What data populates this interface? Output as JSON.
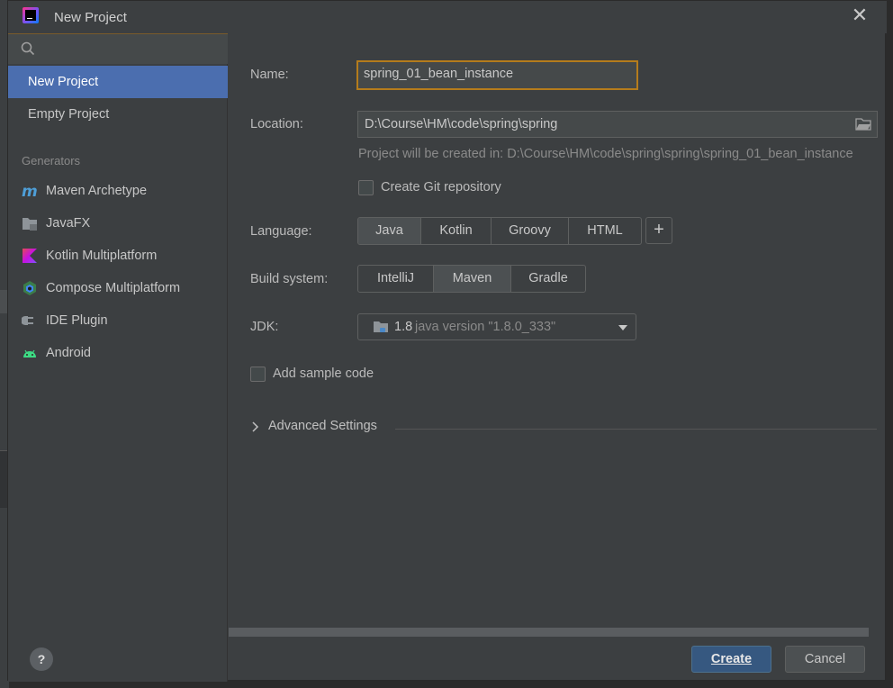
{
  "dialog": {
    "title": "New Project",
    "close_glyph": "✕"
  },
  "sidebar": {
    "search_placeholder": "",
    "project_types": [
      {
        "label": "New Project",
        "selected": true
      },
      {
        "label": "Empty Project",
        "selected": false
      }
    ],
    "generators_title": "Generators",
    "generators": [
      {
        "label": "Maven Archetype",
        "icon": "maven-icon"
      },
      {
        "label": "JavaFX",
        "icon": "javafx-folder-icon"
      },
      {
        "label": "Kotlin Multiplatform",
        "icon": "kotlin-icon"
      },
      {
        "label": "Compose Multiplatform",
        "icon": "compose-icon"
      },
      {
        "label": "IDE Plugin",
        "icon": "plugin-icon"
      },
      {
        "label": "Android",
        "icon": "android-icon"
      }
    ]
  },
  "form": {
    "name_label": "Name:",
    "name_value": "spring_01_bean_instance",
    "location_label": "Location:",
    "location_value": "D:\\Course\\HM\\code\\spring\\spring",
    "location_hint": "Project will be created in: D:\\Course\\HM\\code\\spring\\spring\\spring_01_bean_instance",
    "git_label": "Create Git repository",
    "git_checked": false,
    "language_label": "Language:",
    "languages": [
      {
        "label": "Java",
        "active": true
      },
      {
        "label": "Kotlin",
        "active": false
      },
      {
        "label": "Groovy",
        "active": false
      },
      {
        "label": "HTML",
        "active": false
      }
    ],
    "add_language_glyph": "+",
    "build_label": "Build system:",
    "build_systems": [
      {
        "label": "IntelliJ",
        "active": false
      },
      {
        "label": "Maven",
        "active": true
      },
      {
        "label": "Gradle",
        "active": false
      }
    ],
    "jdk_label": "JDK:",
    "jdk_version": "1.8",
    "jdk_desc": "java version \"1.8.0_333\"",
    "sample_label": "Add sample code",
    "sample_checked": false,
    "advanced_label": "Advanced Settings"
  },
  "footer": {
    "help_glyph": "?",
    "create_label": "Create",
    "cancel_label": "Cancel"
  },
  "colors": {
    "accent_selected": "#4b6eaf",
    "focus_border": "#b57c1c",
    "primary_button": "#365880"
  }
}
